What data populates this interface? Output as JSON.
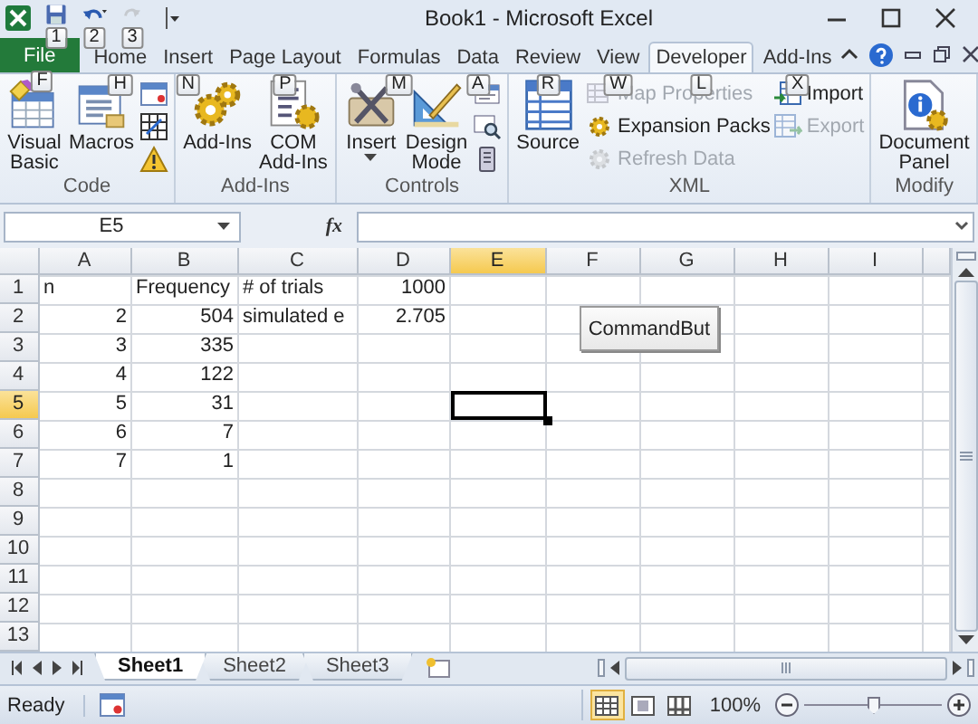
{
  "window": {
    "title": "Book1 - Microsoft Excel"
  },
  "quick_access": [
    {
      "kind": "save",
      "keytip": "1",
      "disabled": false
    },
    {
      "kind": "undo",
      "keytip": "2",
      "disabled": false
    },
    {
      "kind": "redo",
      "keytip": "3",
      "disabled": true
    }
  ],
  "tabs": [
    {
      "kind": "backstage",
      "label": "File",
      "keytip": "F",
      "selected": false
    },
    {
      "kind": "tab",
      "label": "Home",
      "keytip": "H",
      "selected": false
    },
    {
      "kind": "tab",
      "label": "Insert",
      "keytip": "N",
      "selected": false
    },
    {
      "kind": "tab",
      "label": "Page Layout",
      "keytip": "P",
      "selected": false
    },
    {
      "kind": "tab",
      "label": "Formulas",
      "keytip": "M",
      "selected": false
    },
    {
      "kind": "tab",
      "label": "Data",
      "keytip": "A",
      "selected": false
    },
    {
      "kind": "tab",
      "label": "Review",
      "keytip": "R",
      "selected": false
    },
    {
      "kind": "tab",
      "label": "View",
      "keytip": "W",
      "selected": false
    },
    {
      "kind": "tab",
      "label": "Developer",
      "keytip": "L",
      "selected": true
    },
    {
      "kind": "tab",
      "label": "Add-Ins",
      "keytip": "X",
      "selected": false
    }
  ],
  "ribbon": {
    "groups": [
      {
        "label": "Code",
        "columns": [
          {
            "kind": "large",
            "button": {
              "kind": "vba",
              "label": "Visual Basic",
              "disabled": false,
              "dropdown": false
            }
          },
          {
            "kind": "large",
            "button": {
              "kind": "macros",
              "label": "Macros",
              "disabled": false,
              "dropdown": false
            }
          },
          {
            "kind": "stack",
            "buttons": [
              {
                "kind": "record",
                "disabled": false
              },
              {
                "kind": "relative",
                "disabled": false
              },
              {
                "kind": "security",
                "disabled": false
              }
            ]
          }
        ]
      },
      {
        "label": "Add-Ins",
        "columns": [
          {
            "kind": "large",
            "button": {
              "kind": "addins",
              "label": "Add-Ins",
              "disabled": false,
              "dropdown": false
            }
          },
          {
            "kind": "large",
            "button": {
              "kind": "com",
              "label": "COM Add-Ins",
              "disabled": false,
              "dropdown": false
            }
          }
        ]
      },
      {
        "label": "Controls",
        "columns": [
          {
            "kind": "large",
            "button": {
              "kind": "insert",
              "label": "Insert",
              "disabled": false,
              "dropdown": true
            }
          },
          {
            "kind": "large",
            "button": {
              "kind": "design",
              "label": "Design Mode",
              "disabled": false,
              "dropdown": false
            }
          },
          {
            "kind": "stack",
            "buttons": [
              {
                "kind": "properties",
                "disabled": false
              },
              {
                "kind": "code",
                "disabled": false
              },
              {
                "kind": "dialog",
                "disabled": false
              }
            ]
          }
        ]
      },
      {
        "label": "XML",
        "columns": [
          {
            "kind": "large",
            "button": {
              "kind": "source",
              "label": "Source",
              "disabled": false,
              "dropdown": false
            }
          },
          {
            "kind": "stack",
            "buttons": [
              {
                "kind": "map",
                "label": "Map Properties",
                "disabled": true
              },
              {
                "kind": "expansion",
                "label": "Expansion Packs",
                "disabled": false
              },
              {
                "kind": "refresh",
                "label": "Refresh Data",
                "disabled": true
              }
            ]
          },
          {
            "kind": "stack",
            "buttons": [
              {
                "kind": "import",
                "label": "Import",
                "disabled": false
              },
              {
                "kind": "export",
                "label": "Export",
                "disabled": true
              }
            ]
          }
        ]
      },
      {
        "label": "Modify",
        "columns": [
          {
            "kind": "large",
            "button": {
              "kind": "panel",
              "label": "Document Panel",
              "disabled": false,
              "dropdown": false
            }
          }
        ]
      }
    ]
  },
  "formula_bar": {
    "name_box": "E5",
    "function_button": "fx"
  },
  "sheet": {
    "columns": [
      {
        "label": "A",
        "selected": false
      },
      {
        "label": "B",
        "selected": false
      },
      {
        "label": "C",
        "selected": false
      },
      {
        "label": "D",
        "selected": false
      },
      {
        "label": "E",
        "selected": true
      },
      {
        "label": "F",
        "selected": false
      },
      {
        "label": "G",
        "selected": false
      },
      {
        "label": "H",
        "selected": false
      },
      {
        "label": "I",
        "selected": false
      }
    ],
    "rows": [
      {
        "label": "1",
        "selected": false,
        "cells": [
          {
            "text": "n",
            "kind": "text"
          },
          {
            "text": "Frequency",
            "kind": "text"
          },
          {
            "text": "# of trials",
            "kind": "text"
          },
          {
            "text": "1000",
            "kind": "number"
          }
        ]
      },
      {
        "label": "2",
        "selected": false,
        "cells": [
          {
            "text": "2",
            "kind": "number"
          },
          {
            "text": "504",
            "kind": "number"
          },
          {
            "text": "simulated e",
            "kind": "text"
          },
          {
            "text": "2.705",
            "kind": "number"
          }
        ]
      },
      {
        "label": "3",
        "selected": false,
        "cells": [
          {
            "text": "3",
            "kind": "number"
          },
          {
            "text": "335",
            "kind": "number"
          }
        ]
      },
      {
        "label": "4",
        "selected": false,
        "cells": [
          {
            "text": "4",
            "kind": "number"
          },
          {
            "text": "122",
            "kind": "number"
          }
        ]
      },
      {
        "label": "5",
        "selected": true,
        "cells": [
          {
            "text": "5",
            "kind": "number"
          },
          {
            "text": "31",
            "kind": "number"
          }
        ]
      },
      {
        "label": "6",
        "selected": false,
        "cells": [
          {
            "text": "6",
            "kind": "number"
          },
          {
            "text": "7",
            "kind": "number"
          }
        ]
      },
      {
        "label": "7",
        "selected": false,
        "cells": [
          {
            "text": "7",
            "kind": "number"
          },
          {
            "text": "1",
            "kind": "number"
          }
        ]
      },
      {
        "label": "8",
        "selected": false,
        "cells": []
      },
      {
        "label": "9",
        "selected": false,
        "cells": []
      },
      {
        "label": "10",
        "selected": false,
        "cells": []
      },
      {
        "label": "11",
        "selected": false,
        "cells": []
      },
      {
        "label": "12",
        "selected": false,
        "cells": []
      },
      {
        "label": "13",
        "selected": false,
        "cells": []
      }
    ],
    "command_button": {
      "label": "CommandBut"
    }
  },
  "sheet_tabs": [
    {
      "label": "Sheet1",
      "selected": true
    },
    {
      "label": "Sheet2",
      "selected": false
    },
    {
      "label": "Sheet3",
      "selected": false
    }
  ],
  "status_bar": {
    "status": "Ready",
    "views": [
      {
        "kind": "normal",
        "selected": true
      },
      {
        "kind": "layout",
        "selected": false
      },
      {
        "kind": "breaks",
        "selected": false
      }
    ],
    "zoom": {
      "reading": "100%",
      "level": 0.5
    }
  }
}
